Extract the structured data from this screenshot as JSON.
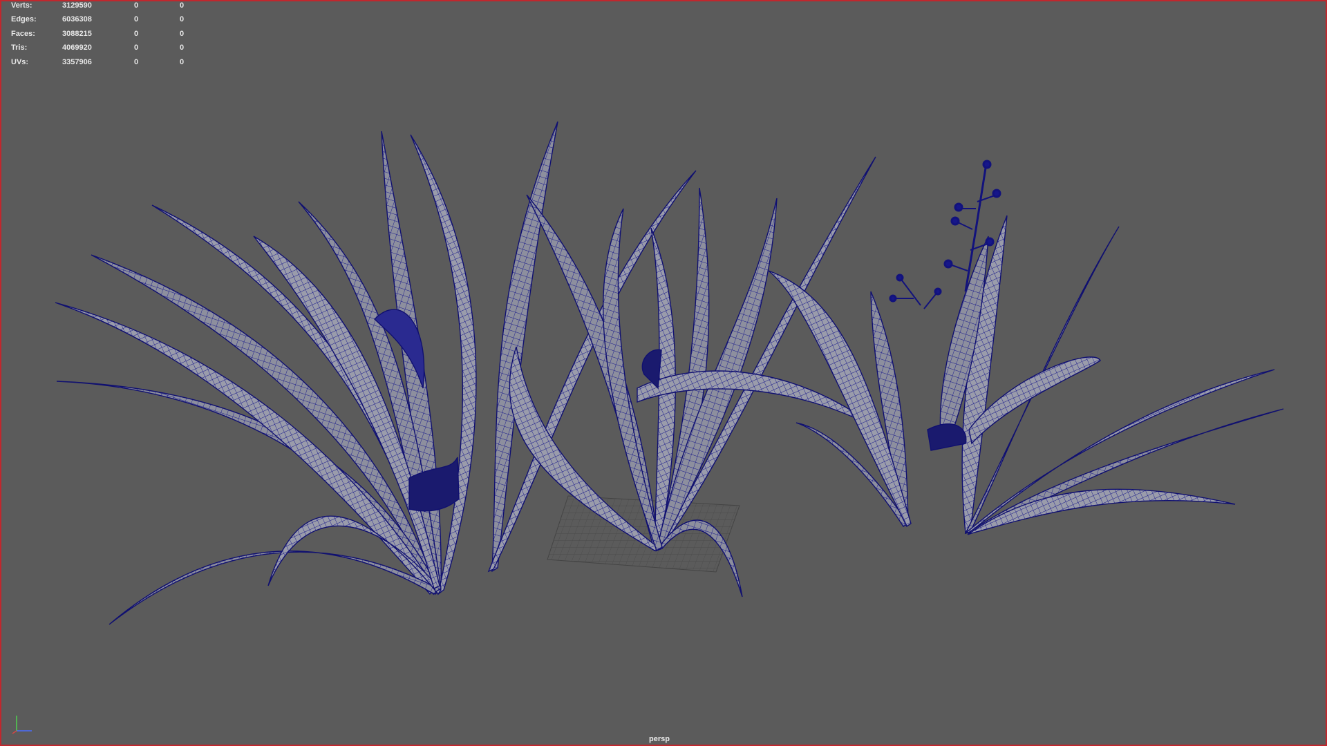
{
  "hud": {
    "rows": [
      {
        "label": "Verts:",
        "total": "3129590",
        "selected": "0",
        "component": "0"
      },
      {
        "label": "Edges:",
        "total": "6036308",
        "selected": "0",
        "component": "0"
      },
      {
        "label": "Faces:",
        "total": "3088215",
        "selected": "0",
        "component": "0"
      },
      {
        "label": "Tris:",
        "total": "4069920",
        "selected": "0",
        "component": "0"
      },
      {
        "label": "UVs:",
        "total": "3357906",
        "selected": "0",
        "component": "0"
      }
    ]
  },
  "viewport": {
    "camera": "persp",
    "border_color": "#c1272d",
    "background_color": "#5b5b5b",
    "mesh_fill": "#8d8f9e",
    "wire_color": "#16168a"
  },
  "axis_gizmo": {
    "icon": "axis-gizmo-icon",
    "x_color": "#d64545",
    "y_color": "#4fd14f",
    "z_color": "#4a6cff"
  }
}
